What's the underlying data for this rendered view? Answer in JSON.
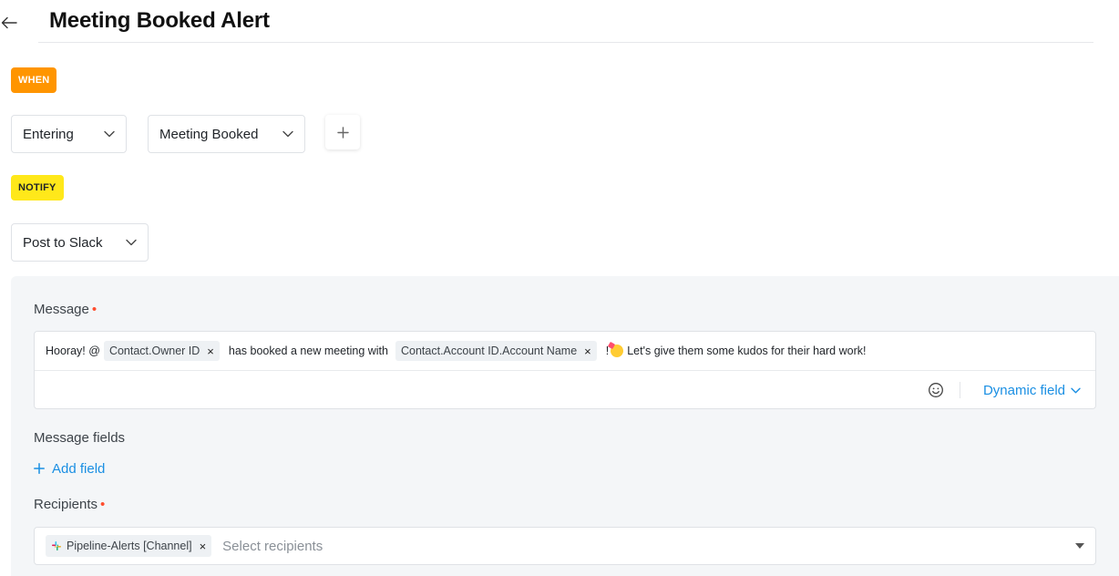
{
  "header": {
    "title": "Meeting Booked Alert",
    "back_icon": "arrow-left-icon"
  },
  "trigger": {
    "tag": "WHEN",
    "tag_color": "#ff9500",
    "event_select": "Entering",
    "stage_select": "Meeting Booked",
    "add_icon": "plus-icon"
  },
  "action": {
    "tag": "NOTIFY",
    "tag_color": "#ffe81a",
    "action_select": "Post to Slack"
  },
  "message": {
    "label": "Message",
    "required_mark": "•",
    "segments": {
      "prefix": "Hooray! @",
      "chip_owner": "Contact.Owner ID",
      "middle": "has booked a new meeting with",
      "chip_account": "Contact.Account ID.Account Name",
      "bang": "!",
      "suffix": "Let's give them some kudos for their hard work!"
    },
    "chip_remove": "×",
    "emoji_icon": "smiley-face-icon",
    "dynamic_field_label": "Dynamic field"
  },
  "message_fields": {
    "label": "Message fields",
    "add_field_label": "Add field"
  },
  "recipients": {
    "label": "Recipients",
    "required_mark": "•",
    "chip": "Pipeline-Alerts [Channel]",
    "chip_remove": "×",
    "placeholder": "Select recipients"
  },
  "colors": {
    "accent": "#1a8fe3",
    "required": "#ff4d2e",
    "panel_bg": "#f4f6f8"
  }
}
